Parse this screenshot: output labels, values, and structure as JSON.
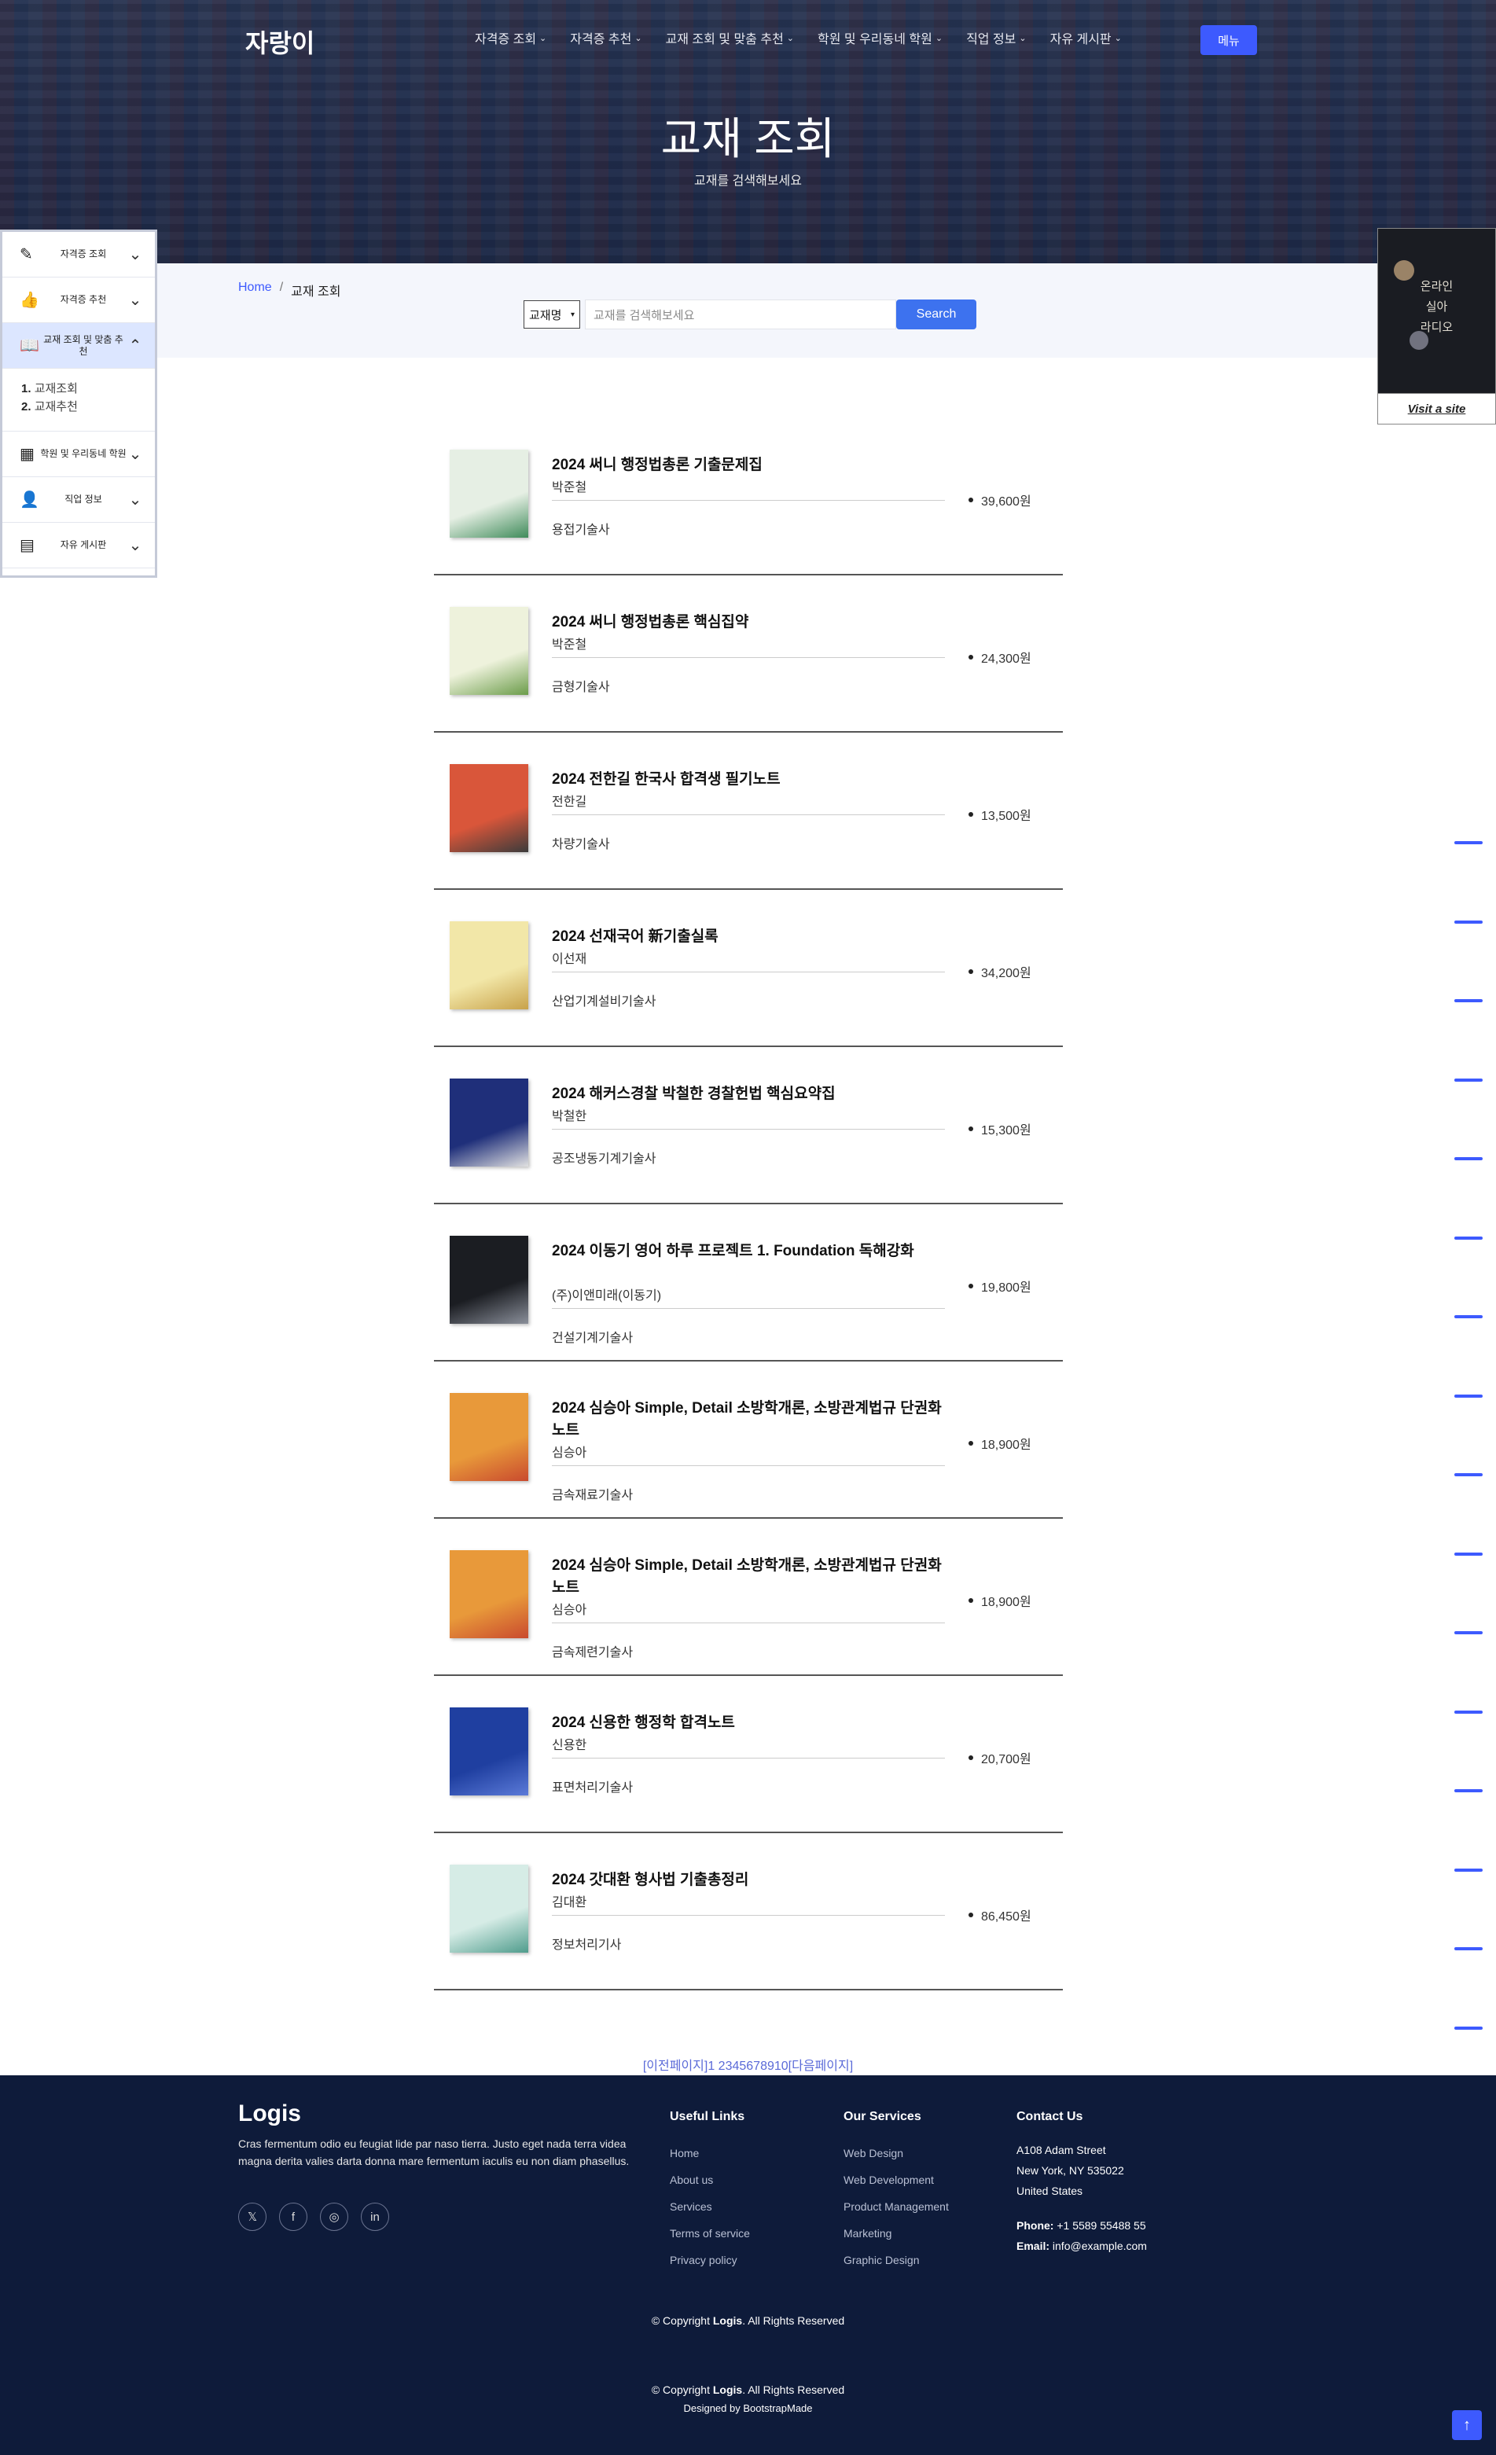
{
  "header": {
    "logo": "자랑이",
    "nav": [
      {
        "label": "자격증 조회",
        "chev": "⌄"
      },
      {
        "label": "자격증 추천",
        "chev": "⌄"
      },
      {
        "label": "교재 조회 및 맞춤 추천",
        "chev": "⌄"
      },
      {
        "label": "학원 및 우리동네 학원",
        "chev": "⌄"
      },
      {
        "label": "직업 정보",
        "chev": "⌄"
      },
      {
        "label": "자유 게시판",
        "chev": "⌄"
      }
    ],
    "menu_button": "메뉴",
    "title": "교재 조회",
    "subtitle": "교재를 검색해보세요"
  },
  "breadcrumb": {
    "home": "Home",
    "separator": "/",
    "current": "교재 조회"
  },
  "search": {
    "select_value": "교재명",
    "placeholder": "교재를 검색해보세요",
    "button": "Search"
  },
  "sidebar": {
    "items": [
      {
        "label": "자격증 조회",
        "icon": "edit-icon"
      },
      {
        "label": "자격증 추천",
        "icon": "thumbs-up-icon"
      },
      {
        "label": "교재 조회 및 맞춤 추천",
        "icon": "book-icon"
      },
      {
        "label": "학원 및 우리동네 학원",
        "icon": "map-icon"
      },
      {
        "label": "직업 정보",
        "icon": "person-icon"
      },
      {
        "label": "자유 게시판",
        "icon": "board-icon"
      }
    ],
    "sub": [
      {
        "num": "1.",
        "label": "교재조회"
      },
      {
        "num": "2.",
        "label": "교재추천"
      }
    ]
  },
  "ad": {
    "lines": [
      "온라인",
      "실아",
      "라디오"
    ],
    "link": "Visit a site"
  },
  "books": [
    {
      "title": "2024 써니 행정법총론 기출문제집",
      "author": "박준철",
      "category": "용접기술사",
      "price": "39,600원",
      "cover": "#e6efe4",
      "accent": "#3f8b5a"
    },
    {
      "title": "2024 써니 행정법총론 핵심집약",
      "author": "박준철",
      "category": "금형기술사",
      "price": "24,300원",
      "cover": "#eef2dc",
      "accent": "#6b9c4a"
    },
    {
      "title": "2024 전한길 한국사 합격생 필기노트",
      "author": "전한길",
      "category": "차량기술사",
      "price": "13,500원",
      "cover": "#d9563a",
      "accent": "#3b3b3b"
    },
    {
      "title": "2024 선재국어 新기출실록",
      "author": "이선재",
      "category": "산업기계설비기술사",
      "price": "34,200원",
      "cover": "#f2e7a8",
      "accent": "#c8a24a"
    },
    {
      "title": "2024 해커스경찰 박철한 경찰헌법 핵심요약집",
      "author": "박철한",
      "category": "공조냉동기계기술사",
      "price": "15,300원",
      "cover": "#1f2f7a",
      "accent": "#e1e1e1"
    },
    {
      "title": "2024 이동기 영어 하루 프로젝트 1. Foundation 독해강화",
      "author": "(주)이앤미래(이동기)",
      "category": "건설기계기술사",
      "price": "19,800원",
      "cover": "#1b1d22",
      "accent": "#8a8f9a"
    },
    {
      "title": "2024 심승아 Simple, Detail 소방학개론, 소방관계법규 단권화 노트",
      "author": "심승아",
      "category": "금속재료기술사",
      "price": "18,900원",
      "cover": "#e8993a",
      "accent": "#c94a2e"
    },
    {
      "title": "2024 심승아 Simple, Detail 소방학개론, 소방관계법규 단권화 노트",
      "author": "심승아",
      "category": "금속제련기술사",
      "price": "18,900원",
      "cover": "#e8993a",
      "accent": "#c94a2e"
    },
    {
      "title": "2024 신용한 행정학 합격노트",
      "author": "신용한",
      "category": "표면처리기술사",
      "price": "20,700원",
      "cover": "#1f3fa0",
      "accent": "#5b7ad8"
    },
    {
      "title": "2024 갓대환 형사법 기출총정리",
      "author": "김대환",
      "category": "정보처리기사",
      "price": "86,450원",
      "cover": "#d6ece6",
      "accent": "#4f9c8c"
    }
  ],
  "pagination": "[이전페이지]1 2345678910[다음페이지]",
  "footer": {
    "logo": "Logis",
    "description": "Cras fermentum odio eu feugiat lide par naso tierra. Justo eget nada terra videa magna derita valies darta donna mare fermentum iaculis eu non diam phasellus.",
    "social": [
      {
        "name": "twitter-icon",
        "glyph": "𝕏"
      },
      {
        "name": "facebook-icon",
        "glyph": "f"
      },
      {
        "name": "instagram-icon",
        "glyph": "◎"
      },
      {
        "name": "linkedin-icon",
        "glyph": "in"
      }
    ],
    "useful_title": "Useful Links",
    "useful": [
      "Home",
      "About us",
      "Services",
      "Terms of service",
      "Privacy policy"
    ],
    "services_title": "Our Services",
    "services": [
      "Web Design",
      "Web Development",
      "Product Management",
      "Marketing",
      "Graphic Design"
    ],
    "contact_title": "Contact Us",
    "address": [
      "A108 Adam Street",
      "New York, NY 535022",
      "United States"
    ],
    "phone_label": "Phone:",
    "phone": "+1 5589 55488 55",
    "email_label": "Email:",
    "email": "info@example.com",
    "copyright_pre": "© Copyright",
    "copyright_brand": "Logis",
    "copyright_post": ". All Rights Reserved",
    "designed": "Designed by BootstrapMade"
  }
}
